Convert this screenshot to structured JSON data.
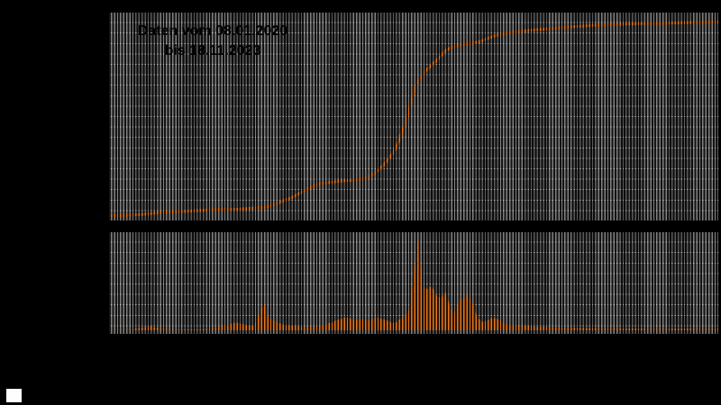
{
  "annotation": {
    "line1": "Daten vom 08.01.2020",
    "line2": "bis 18.11.2023"
  },
  "legend": {
    "marker_color": "#fdfdfd"
  },
  "colors": {
    "background": "#000000",
    "series_orange": "#E8771C",
    "band_light": "#7f7f7f",
    "band_dark": "#585858",
    "horizontal_grid": "rgba(255,255,255,0.5)",
    "vertical_stripes": "rgba(0,0,0,0.85)",
    "annotation_text": "#000000"
  },
  "chart_data": [
    {
      "type": "line",
      "name": "cumulative-total",
      "annotation": "Daten vom 08.01.2020 bis 18.11.2023",
      "x_start_date": "08.01.2020",
      "x_end_date": "18.11.2023",
      "x_unit": "fraction_of_date_range",
      "y_unit": "percent_of_final_value",
      "ylim": [
        0,
        105
      ],
      "grid": true,
      "axis_tick_labels_visible": false,
      "legend_position": "none",
      "color": "#E8771C",
      "x": [
        0.0,
        0.028,
        0.058,
        0.087,
        0.117,
        0.146,
        0.176,
        0.206,
        0.235,
        0.257,
        0.272,
        0.287,
        0.302,
        0.317,
        0.331,
        0.346,
        0.361,
        0.383,
        0.405,
        0.42,
        0.435,
        0.45,
        0.464,
        0.472,
        0.479,
        0.487,
        0.494,
        0.501,
        0.509,
        0.516,
        0.524,
        0.531,
        0.538,
        0.546,
        0.553,
        0.561,
        0.571,
        0.583,
        0.598,
        0.612,
        0.627,
        0.638,
        0.649,
        0.664,
        0.679,
        0.694,
        0.709,
        0.731,
        0.753,
        0.775,
        0.797,
        0.82,
        0.842,
        0.871,
        0.901,
        0.93,
        0.96,
        1.0
      ],
      "y": [
        1.4,
        1.8,
        2.3,
        3.2,
        3.7,
        4.1,
        4.6,
        4.6,
        5.3,
        5.9,
        7.3,
        9.2,
        11.0,
        13.7,
        16.0,
        17.8,
        18.5,
        19.2,
        19.7,
        20.4,
        22.9,
        27.0,
        32.5,
        36.6,
        42.6,
        49.0,
        57.2,
        65.4,
        70.5,
        74.1,
        76.4,
        78.7,
        80.5,
        83.3,
        85.6,
        87.0,
        87.9,
        88.8,
        89.2,
        90.4,
        92.4,
        93.4,
        94.0,
        95.0,
        95.4,
        95.9,
        96.3,
        96.8,
        97.5,
        97.9,
        98.4,
        98.6,
        98.9,
        99.2,
        99.4,
        99.6,
        99.8,
        100.0
      ]
    },
    {
      "type": "area",
      "name": "daily-values",
      "x_start_date": "08.01.2020",
      "x_end_date": "18.11.2023",
      "x_unit": "fraction_of_date_range",
      "y_unit": "percent_of_peak_value",
      "ylim": [
        0,
        105
      ],
      "grid": true,
      "axis_tick_labels_visible": false,
      "legend_position": "none",
      "color": "#E8771C",
      "values": [
        0.5,
        0.5,
        0.5,
        0.5,
        0.7,
        1,
        2,
        2.5,
        3.7,
        4.6,
        3,
        2.8,
        2,
        1.8,
        1.2,
        1,
        1,
        1,
        1,
        1,
        1,
        1.2,
        1.5,
        2.8,
        3,
        4.6,
        5.5,
        7.3,
        8.3,
        7,
        6,
        4.6,
        6,
        18,
        30,
        14,
        11,
        9,
        6.5,
        5.5,
        5.5,
        4.5,
        3.7,
        3.7,
        3.7,
        3.7,
        4.6,
        5,
        7.5,
        8.3,
        11,
        12,
        14,
        13,
        11,
        12,
        12,
        10,
        12,
        14,
        12,
        11,
        8.5,
        8,
        12,
        14,
        23,
        60,
        100,
        46,
        44,
        48,
        37,
        35,
        41,
        25,
        18,
        32,
        35,
        39,
        28,
        14,
        9,
        10,
        13,
        13,
        11,
        7,
        6,
        5,
        4.6,
        4.6,
        4.6,
        4,
        3.7,
        3.7,
        4,
        3.7,
        3.3,
        3,
        2.8,
        2.8,
        2.8,
        2.5,
        2.5,
        2.5,
        2.3,
        2.3,
        2.3,
        2,
        2,
        2,
        2,
        1.8,
        1.8,
        1.8,
        1.8,
        1.8,
        1.8,
        1.8,
        1.8,
        1.8,
        1.8,
        1.8,
        1.8,
        1.8,
        1.8,
        1.8,
        1.8,
        1.8,
        1.8,
        1.8,
        1.8,
        1.8,
        1.8
      ]
    }
  ]
}
